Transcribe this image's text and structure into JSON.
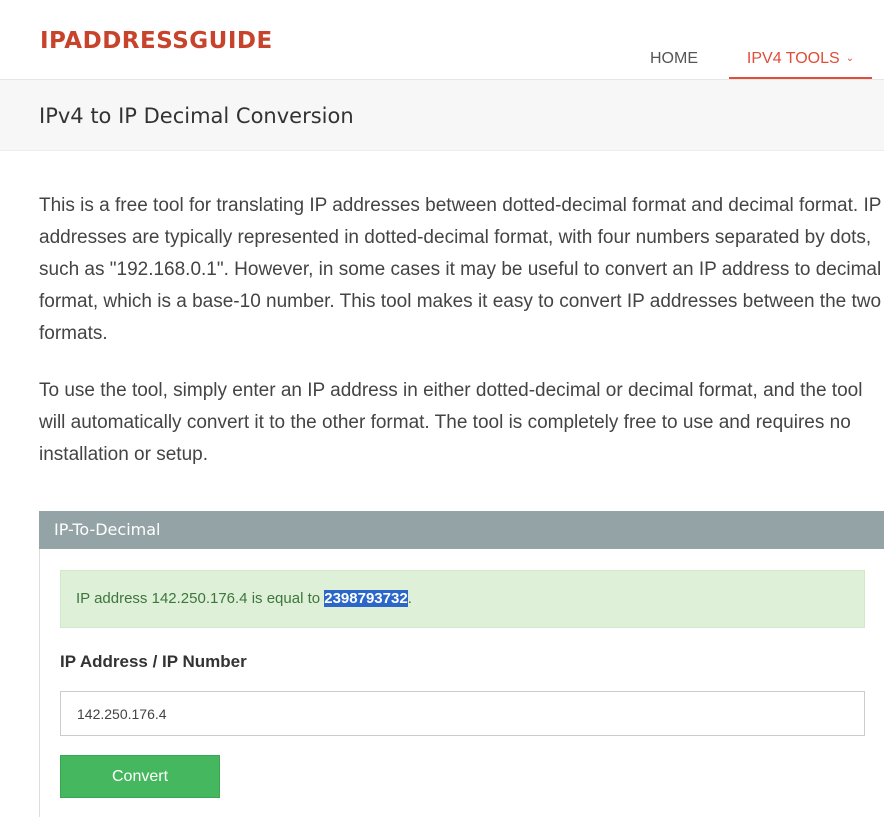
{
  "brand": {
    "logo_text": "IPADDRESSGUIDE",
    "accent_color": "#c8432c"
  },
  "nav": {
    "home_label": "HOME",
    "tools_label": "IPV4 TOOLS",
    "tools_icon": "chevron-down-icon",
    "active_color": "#e04d38"
  },
  "page": {
    "title": "IPv4 to IP Decimal Conversion"
  },
  "intro": {
    "paragraph_1": "This is a free tool for translating IP addresses between dotted-decimal format and decimal format. IP addresses are typically represented in dotted-decimal format, with four numbers separated by dots, such as \"192.168.0.1\". However, in some cases it may be useful to convert an IP address to decimal format, which is a base-10 number. This tool makes it easy to convert IP addresses between the two formats.",
    "paragraph_2": "To use the tool, simply enter an IP address in either dotted-decimal or decimal format, and the tool will automatically convert it to the other format. The tool is completely free to use and requires no installation or setup."
  },
  "tool": {
    "panel_title": "IP-To-Decimal",
    "panel_header_color": "#94a3a6",
    "result": {
      "prefix": "IP address 142.250.176.4 is equal to ",
      "value": "2398793732",
      "suffix": "."
    },
    "field_label": "IP Address / IP Number",
    "input_value": "142.250.176.4",
    "button_label": "Convert",
    "button_color": "#45b75e"
  }
}
